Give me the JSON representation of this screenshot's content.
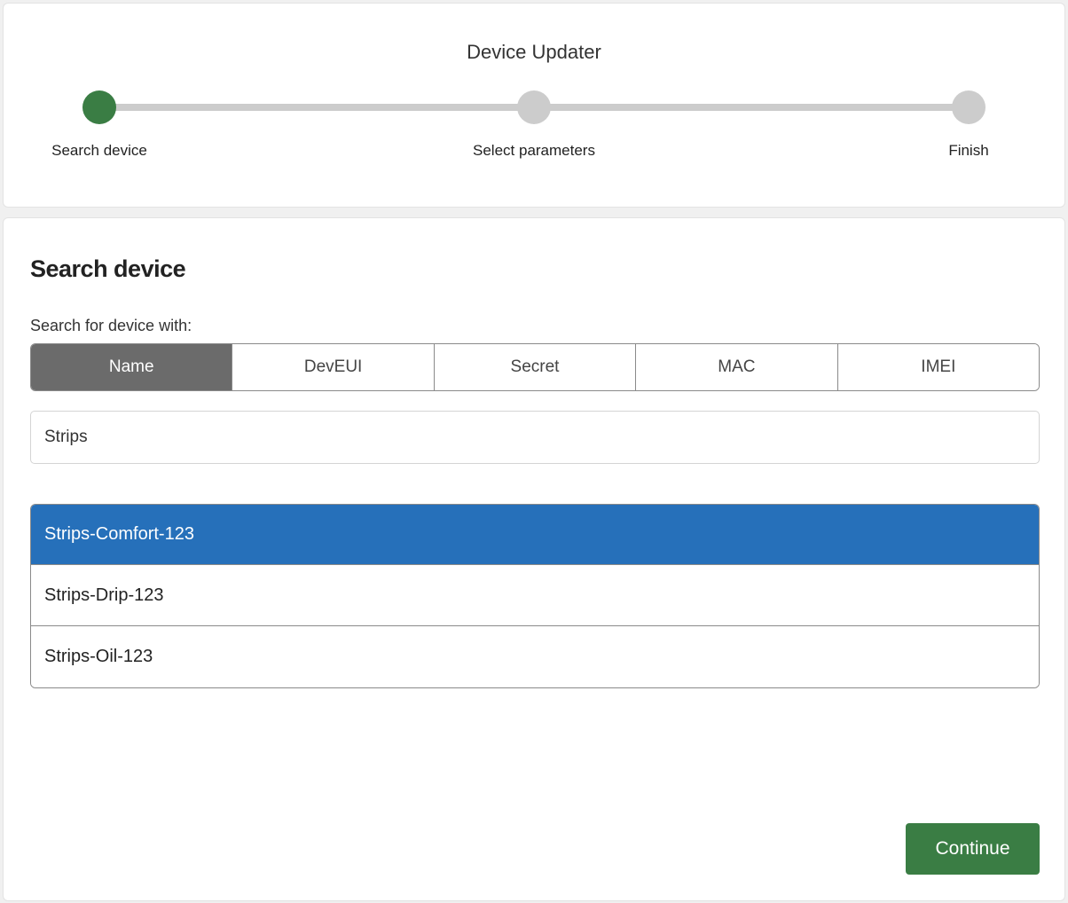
{
  "app": {
    "title": "Device Updater"
  },
  "stepper": {
    "steps": [
      {
        "label": "Search device",
        "state": "active"
      },
      {
        "label": "Select parameters",
        "state": "inactive"
      },
      {
        "label": "Finish",
        "state": "inactive"
      }
    ],
    "active_color": "#3a7d44",
    "inactive_color": "#cccccc"
  },
  "search": {
    "title": "Search device",
    "field_label": "Search for device with:",
    "modes": [
      "Name",
      "DevEUI",
      "Secret",
      "MAC",
      "IMEI"
    ],
    "selected_mode": "Name",
    "query": "Strips"
  },
  "results": {
    "items": [
      "Strips-Comfort-123",
      "Strips-Drip-123",
      "Strips-Oil-123"
    ],
    "selected": "Strips-Comfort-123",
    "highlight_color": "#2670ba"
  },
  "actions": {
    "continue_label": "Continue",
    "continue_color": "#3a7d44"
  }
}
